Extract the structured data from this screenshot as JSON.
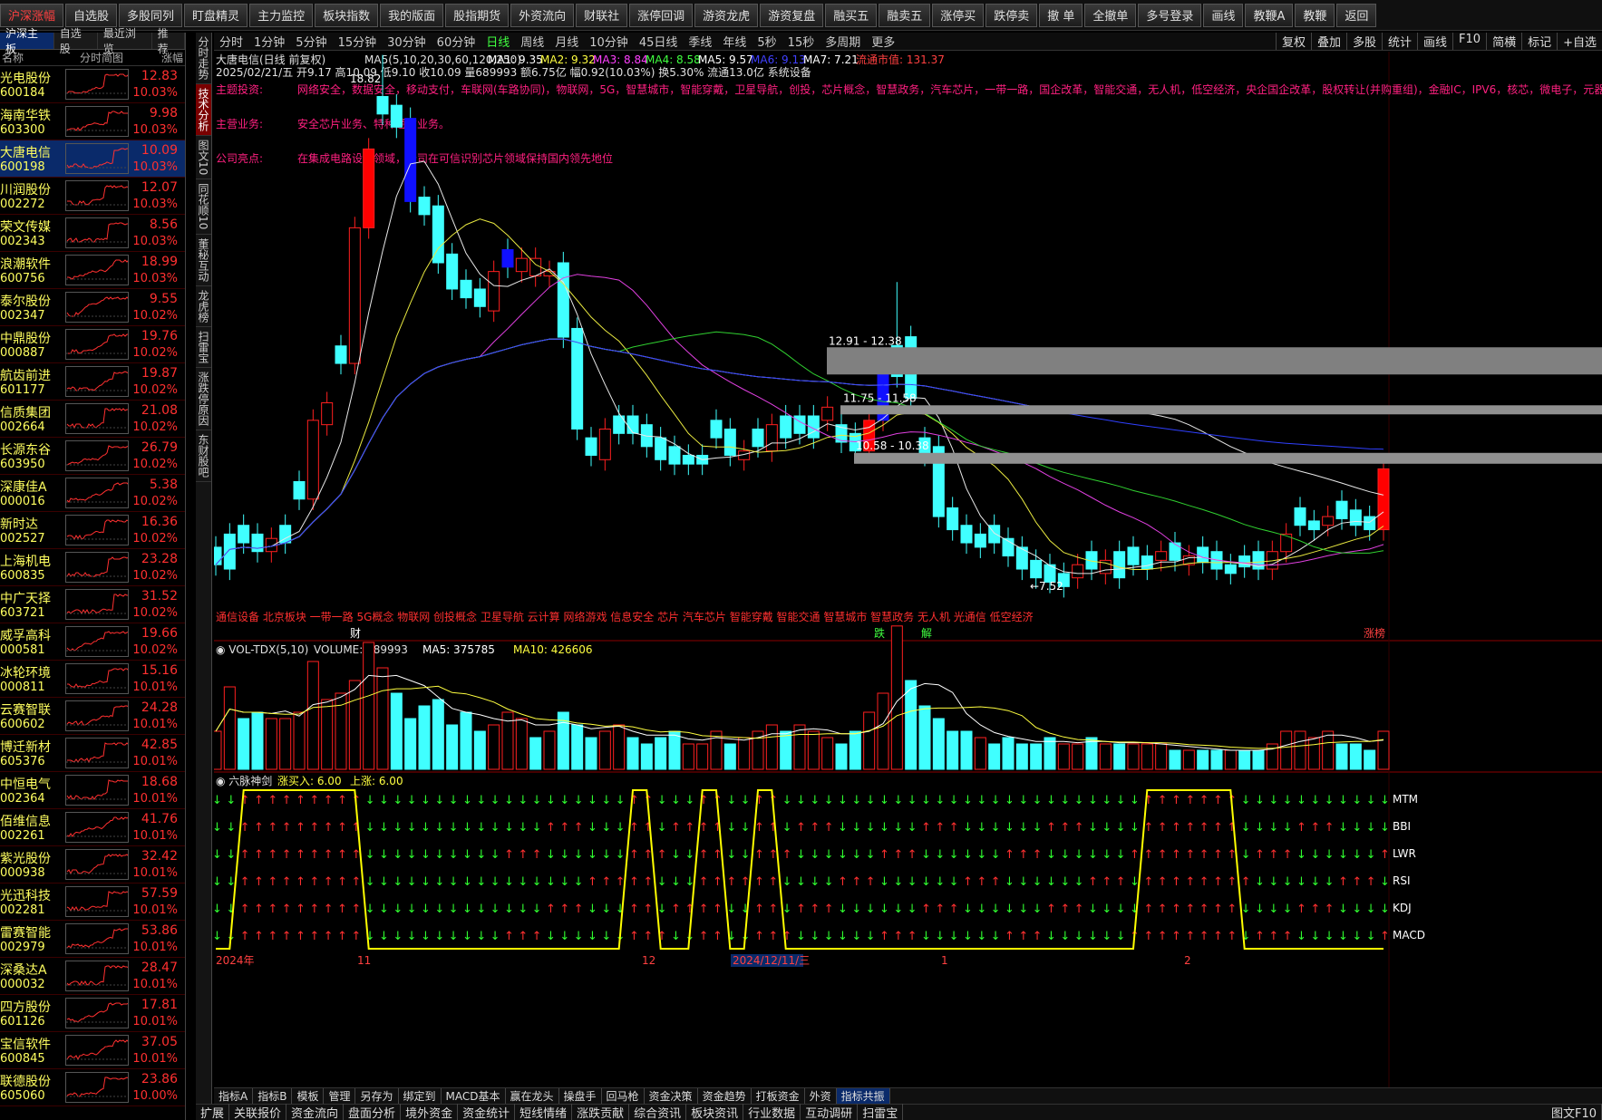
{
  "toolbar": [
    "沪深涨幅",
    "自选股",
    "多股同列",
    "盯盘精灵",
    "主力监控",
    "板块指数",
    "我的版面",
    "股指期货",
    "外资流向",
    "财联社",
    "涨停回调",
    "游资龙虎",
    "游资复盘",
    "融买五",
    "融卖五",
    "涨停买",
    "跌停卖",
    "撤 单",
    "全撤单",
    "多号登录",
    "画线",
    "教鞭A",
    "教鞭",
    "返回"
  ],
  "list_tabs": [
    "沪深主板",
    "自选股",
    "最近浏览",
    "推荐"
  ],
  "list_header": {
    "name": "名称",
    "spark": "分时简图",
    "pct": "涨幅"
  },
  "stocks": [
    {
      "name": "光电股份",
      "code": "600184",
      "price": "12.83",
      "pct": "10.03%"
    },
    {
      "name": "海南华铁",
      "code": "603300",
      "price": "9.98",
      "pct": "10.03%"
    },
    {
      "name": "大唐电信",
      "code": "600198",
      "price": "10.09",
      "pct": "10.03%"
    },
    {
      "name": "川润股份",
      "code": "002272",
      "price": "12.07",
      "pct": "10.03%"
    },
    {
      "name": "荣文传媒",
      "code": "002343",
      "price": "8.56",
      "pct": "10.03%"
    },
    {
      "name": "浪潮软件",
      "code": "600756",
      "price": "18.99",
      "pct": "10.03%"
    },
    {
      "name": "泰尔股份",
      "code": "002347",
      "price": "9.55",
      "pct": "10.02%"
    },
    {
      "name": "中鼎股份",
      "code": "000887",
      "price": "19.76",
      "pct": "10.02%"
    },
    {
      "name": "航齿前进",
      "code": "601177",
      "price": "19.87",
      "pct": "10.02%"
    },
    {
      "name": "信质集团",
      "code": "002664",
      "price": "21.08",
      "pct": "10.02%"
    },
    {
      "name": "长源东谷",
      "code": "603950",
      "price": "26.79",
      "pct": "10.02%"
    },
    {
      "name": "深康佳A",
      "code": "000016",
      "price": "5.38",
      "pct": "10.02%"
    },
    {
      "name": "新时达",
      "code": "002527",
      "price": "16.36",
      "pct": "10.02%"
    },
    {
      "name": "上海机电",
      "code": "600835",
      "price": "23.28",
      "pct": "10.02%"
    },
    {
      "name": "中广天择",
      "code": "603721",
      "price": "31.52",
      "pct": "10.02%"
    },
    {
      "name": "威孚高科",
      "code": "000581",
      "price": "19.66",
      "pct": "10.02%"
    },
    {
      "name": "冰轮环境",
      "code": "000811",
      "price": "15.16",
      "pct": "10.01%"
    },
    {
      "name": "云赛智联",
      "code": "600602",
      "price": "24.28",
      "pct": "10.01%"
    },
    {
      "name": "博迁新材",
      "code": "605376",
      "price": "42.85",
      "pct": "10.01%"
    },
    {
      "name": "中恒电气",
      "code": "002364",
      "price": "18.68",
      "pct": "10.01%"
    },
    {
      "name": "佰维信息",
      "code": "002261",
      "price": "41.76",
      "pct": "10.01%"
    },
    {
      "name": "紫光股份",
      "code": "000938",
      "price": "32.42",
      "pct": "10.01%"
    },
    {
      "name": "光迅科技",
      "code": "002281",
      "price": "57.59",
      "pct": "10.01%"
    },
    {
      "name": "雷赛智能",
      "code": "002979",
      "price": "53.86",
      "pct": "10.01%"
    },
    {
      "name": "深桑达A",
      "code": "000032",
      "price": "28.47",
      "pct": "10.01%"
    },
    {
      "name": "四方股份",
      "code": "601126",
      "price": "17.81",
      "pct": "10.01%"
    },
    {
      "name": "宝信软件",
      "code": "600845",
      "price": "37.05",
      "pct": "10.01%"
    },
    {
      "name": "联德股份",
      "code": "605060",
      "price": "23.86",
      "pct": "10.00%"
    }
  ],
  "side_tabs": [
    "分时走势",
    "技术分析",
    "图文10",
    "同花顺10",
    "董秘互动",
    "龙虎榜",
    "扫雷宝",
    "涨跌停原因",
    "东财股吧"
  ],
  "period_tabs": [
    "分时",
    "1分钟",
    "5分钟",
    "15分钟",
    "30分钟",
    "60分钟",
    "日线",
    "周线",
    "月线",
    "10分钟",
    "45日线",
    "季线",
    "年线",
    "5秒",
    "15秒",
    "多周期",
    "更多"
  ],
  "right_tabs": [
    "复权",
    "叠加",
    "多股",
    "统计",
    "画线",
    "F10",
    "简横",
    "标记",
    "+自选"
  ],
  "info": {
    "title": "大唐电信(日线 前复权)",
    "ma_params": "MA5(5,10,20,30,60,120,250)",
    "ma1": "MA1: 9.35",
    "ma2": "MA2: 9.32",
    "ma3": "MA3: 8.84",
    "ma4": "MA4: 8.58",
    "ma5": "MA5: 9.57",
    "ma6": "MA6: 9.13",
    "ma7": "MA7: 7.21",
    "float_mv": "流通市值: 131.37",
    "line2": "2025/02/21/五 开9.17 高10.09 低9.10 收10.09 量689993 额6.75亿 幅0.92(10.03%) 换5.30% 流通13.0亿 系统设备",
    "concept_label": "主题投资:",
    "concept": "网络安全，数据安全，移动支付，车联网(车路协同)，物联网，5G，智慧城市，智能穿戴，卫星导航，创投，芯片概念，智慧政务，汽车芯片，一带一路，国企改革，智能交通，无人机，低空经济，央企国企改革，股权转让(并购重组)，金融IC，IPV6，核芯，微电子，元器",
    "business_label": "主营业务:",
    "business": "安全芯片业务、特种通信业务。",
    "highlight_label": "公司亮点:",
    "highlight": "在集成电路设计领域，公司在可信识别芯片领域保持国内领先地位",
    "high_mark": "18.82",
    "low_mark": "7.52",
    "zone1": "12.91 - 12.38",
    "zone2": "11.75 - 11.58",
    "zone3": "10.58 - 10.38",
    "tags": "通信设备 北京板块 一带一路 5G概念 物联网 创投概念 卫星导航 云计算 网络游戏 信息安全 芯片 汽车芯片 智能穿戴 智能交通 智慧城市 智慧政务 无人机 光通信 低空经济",
    "marker_cai": "财",
    "marker_die": "跌",
    "marker_jie": "解",
    "marker_zhang": "涨榜"
  },
  "volume": {
    "title": "VOL-TDX(5,10)",
    "vol": "VOLUME: 689993",
    "ma5": "MA5: 375785",
    "ma10": "MA10: 426606"
  },
  "liumai": {
    "title": "六脉神剑",
    "buy": "涨买入: 6.00",
    "rise": "上涨: 6.00",
    "rows": [
      "MTM",
      "BBI",
      "LWR",
      "RSI",
      "KDJ",
      "MACD"
    ]
  },
  "timeline": [
    "2024年",
    "11",
    "12",
    "2024/12/11/三",
    "1",
    "2"
  ],
  "indicator_tabs": [
    "指标A",
    "指标B",
    "模板",
    "管理",
    "另存为",
    "绑定到",
    "MACD基本",
    "赢在龙头",
    "操盘手",
    "回马枪",
    "资金决策",
    "资金趋势",
    "打板资金",
    "外资",
    "指标共振"
  ],
  "bottom_tabs": [
    "扩展",
    "关联报价",
    "资金流向",
    "盘面分析",
    "境外资金",
    "资金统计",
    "短线情绪",
    "涨跌贡献",
    "综合资讯",
    "板块资讯",
    "行业数据",
    "互动调研",
    "扫雷宝"
  ],
  "bottom_right": "图文F10",
  "colors": {
    "up": "#ff2020",
    "down": "#40ffff",
    "ma_white": "#e8e8e8",
    "ma_yellow": "#e8e840",
    "ma_magenta": "#e040e0",
    "ma_green": "#30d030",
    "ma_blue": "#3040ff"
  }
}
